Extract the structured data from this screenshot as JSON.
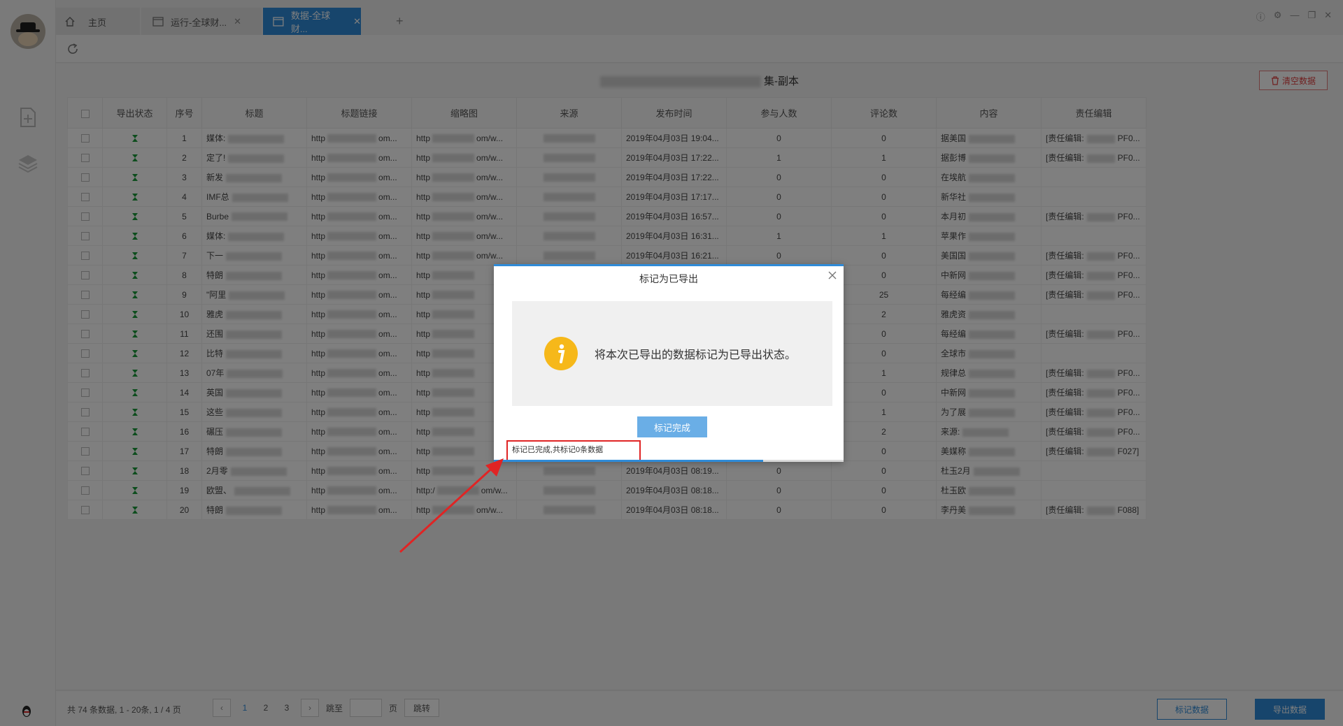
{
  "tabs": {
    "home": "主页",
    "tab1": "运行-全球财...",
    "tab2": "数据-全球财..."
  },
  "page": {
    "title_suffix": "集-副本",
    "clear_button": "清空数据"
  },
  "table": {
    "headers": [
      "",
      "导出状态",
      "序号",
      "标题",
      "标题链接",
      "缩略图",
      "来源",
      "发布时间",
      "参与人数",
      "评论数",
      "内容",
      "责任编辑"
    ],
    "rows": [
      {
        "idx": "1",
        "title": "媒体:",
        "link": "http",
        "thumb": "http",
        "thumb_tail": "om/w...",
        "link_tail": "om...",
        "time": "2019年04月03日 19:04...",
        "people": "0",
        "comments": "0",
        "content": "据美国",
        "editor": "[责任编辑:",
        "editor_tail": "PF0..."
      },
      {
        "idx": "2",
        "title": "定了!",
        "link": "http",
        "thumb": "http",
        "thumb_tail": "om/w...",
        "link_tail": "om...",
        "time": "2019年04月03日 17:22...",
        "people": "1",
        "comments": "1",
        "content": "据彭博",
        "editor": "[责任编辑:",
        "editor_tail": "PF0..."
      },
      {
        "idx": "3",
        "title": "新发",
        "link": "http",
        "thumb": "http",
        "thumb_tail": "om/w...",
        "link_tail": "om...",
        "time": "2019年04月03日 17:22...",
        "people": "0",
        "comments": "0",
        "content": "在埃航",
        "editor": "",
        "editor_tail": ""
      },
      {
        "idx": "4",
        "title": "IMF总",
        "link": "http",
        "thumb": "http",
        "thumb_tail": "om/w...",
        "link_tail": "om...",
        "time": "2019年04月03日 17:17...",
        "people": "0",
        "comments": "0",
        "content": "新华社",
        "editor": "",
        "editor_tail": ""
      },
      {
        "idx": "5",
        "title": "Burbe",
        "link": "http",
        "thumb": "http",
        "thumb_tail": "om/w...",
        "link_tail": "om...",
        "time": "2019年04月03日 16:57...",
        "people": "0",
        "comments": "0",
        "content": "本月初",
        "editor": "[责任编辑:",
        "editor_tail": "PF0..."
      },
      {
        "idx": "6",
        "title": "媒体:",
        "link": "http",
        "thumb": "http",
        "thumb_tail": "om/w...",
        "link_tail": "om...",
        "time": "2019年04月03日 16:31...",
        "people": "1",
        "comments": "1",
        "content": "苹果作",
        "editor": "",
        "editor_tail": ""
      },
      {
        "idx": "7",
        "title": "下一",
        "link": "http",
        "thumb": "http",
        "thumb_tail": "om/w...",
        "link_tail": "om...",
        "time": "2019年04月03日 16:21...",
        "people": "0",
        "comments": "0",
        "content": "美国国",
        "editor": "[责任编辑:",
        "editor_tail": "PF0..."
      },
      {
        "idx": "8",
        "title": "特朗",
        "link": "http",
        "thumb": "http",
        "thumb_tail": "",
        "link_tail": "om...",
        "time": "",
        "people": "",
        "comments": "0",
        "content": "中新网",
        "editor": "[责任编辑:",
        "editor_tail": "PF0..."
      },
      {
        "idx": "9",
        "title": "\"阿里",
        "link": "http",
        "thumb": "http",
        "thumb_tail": "",
        "link_tail": "om...",
        "time": "",
        "people": "",
        "comments": "25",
        "content": "每经编",
        "editor": "[责任编辑:",
        "editor_tail": "PF0..."
      },
      {
        "idx": "10",
        "title": "雅虎",
        "link": "http",
        "thumb": "http",
        "thumb_tail": "",
        "link_tail": "om...",
        "time": "",
        "people": "",
        "comments": "2",
        "content": "雅虎资",
        "editor": "",
        "editor_tail": ""
      },
      {
        "idx": "11",
        "title": "还围",
        "link": "http",
        "thumb": "http",
        "thumb_tail": "",
        "link_tail": "om...",
        "time": "",
        "people": "",
        "comments": "0",
        "content": "每经编",
        "editor": "[责任编辑:",
        "editor_tail": "PF0..."
      },
      {
        "idx": "12",
        "title": "比特",
        "link": "http",
        "thumb": "http",
        "thumb_tail": "",
        "link_tail": "om...",
        "time": "",
        "people": "",
        "comments": "0",
        "content": "全球市",
        "editor": "",
        "editor_tail": ""
      },
      {
        "idx": "13",
        "title": "07年",
        "link": "http",
        "thumb": "http",
        "thumb_tail": "",
        "link_tail": "om...",
        "time": "",
        "people": "",
        "comments": "1",
        "content": "规律总",
        "editor": "[责任编辑:",
        "editor_tail": "PF0..."
      },
      {
        "idx": "14",
        "title": "英国",
        "link": "http",
        "thumb": "http",
        "thumb_tail": "",
        "link_tail": "om...",
        "time": "",
        "people": "",
        "comments": "0",
        "content": "中新网",
        "editor": "[责任编辑:",
        "editor_tail": "PF0..."
      },
      {
        "idx": "15",
        "title": "这些",
        "link": "http",
        "thumb": "http",
        "thumb_tail": "",
        "link_tail": "om...",
        "time": "",
        "people": "",
        "comments": "1",
        "content": "为了展",
        "editor": "[责任编辑:",
        "editor_tail": "PF0..."
      },
      {
        "idx": "16",
        "title": "碾压",
        "link": "http",
        "thumb": "http",
        "thumb_tail": "",
        "link_tail": "om...",
        "time": "",
        "people": "",
        "comments": "2",
        "content": "来源:",
        "editor": "[责任编辑:",
        "editor_tail": "PF0..."
      },
      {
        "idx": "17",
        "title": "特朗",
        "link": "http",
        "thumb": "http",
        "thumb_tail": "",
        "link_tail": "om...",
        "time": "",
        "people": "",
        "comments": "0",
        "content": "美媒称",
        "editor": "[责任编辑:",
        "editor_tail": "F027]"
      },
      {
        "idx": "18",
        "title": "2月零",
        "link": "http",
        "thumb": "http",
        "thumb_tail": "",
        "link_tail": "om...",
        "time": "2019年04月03日 08:19...",
        "people": "0",
        "comments": "0",
        "content": "杜玉2月",
        "editor": "",
        "editor_tail": ""
      },
      {
        "idx": "19",
        "title": "欧盟、",
        "link": "http",
        "thumb": "http:/",
        "thumb_tail": "om/w...",
        "link_tail": "om...",
        "time": "2019年04月03日 08:18...",
        "people": "0",
        "comments": "0",
        "content": "杜玉欧",
        "editor": "",
        "editor_tail": ""
      },
      {
        "idx": "20",
        "title": "特朗",
        "link": "http",
        "thumb": "http",
        "thumb_tail": "om/w...",
        "link_tail": "om...",
        "time": "2019年04月03日 08:18...",
        "people": "0",
        "comments": "0",
        "content": "李丹美",
        "editor": "[责任编辑:",
        "editor_tail": "F088]"
      }
    ]
  },
  "footer": {
    "info": "共 74 条数据, 1 - 20条, 1 / 4 页",
    "pages": [
      "1",
      "2",
      "3"
    ],
    "jump_label": "跳至",
    "page_unit": "页",
    "jump_button": "跳转",
    "mark_button": "标记数据",
    "export_button": "导出数据"
  },
  "dialog": {
    "title": "标记为已导出",
    "message": "将本次已导出的数据标记为已导出状态。",
    "button": "标记完成",
    "status": "标记已完成,共标记0条数据",
    "progress": 0.77
  },
  "colors": {
    "accent": "#2f8bd8",
    "warning": "#f6b81a",
    "annotation": "#e02424",
    "export_icon": "#1a9a3a"
  }
}
